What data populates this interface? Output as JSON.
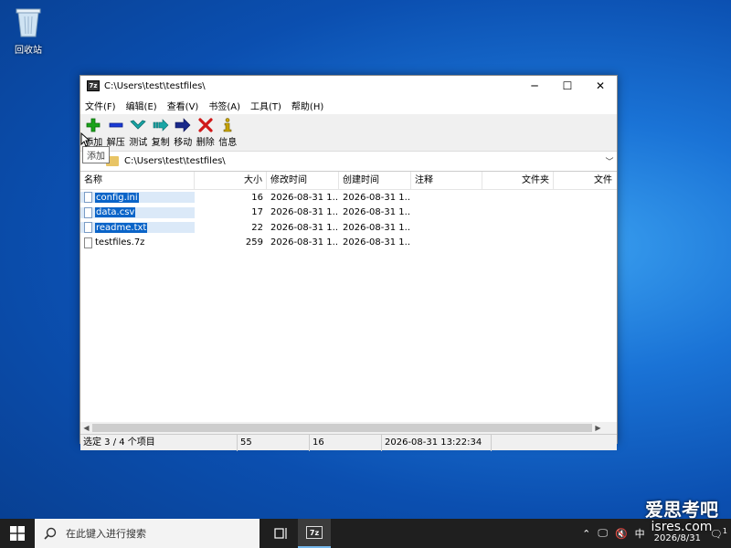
{
  "desktop": {
    "recycle_bin_label": "回收站"
  },
  "window": {
    "title": "C:\\Users\\test\\testfiles\\",
    "app_icon_text": "7z",
    "controls": {
      "minimize": "─",
      "maximize": "☐",
      "close": "✕"
    }
  },
  "menu": [
    "文件(F)",
    "编辑(E)",
    "查看(V)",
    "书签(A)",
    "工具(T)",
    "帮助(H)"
  ],
  "toolbar": [
    {
      "label": "添加",
      "icon": "add-icon",
      "color": "#1aa31a"
    },
    {
      "label": "解压",
      "icon": "extract-icon",
      "color": "#1a3bd6"
    },
    {
      "label": "测试",
      "icon": "test-icon",
      "color": "#19a6a6"
    },
    {
      "label": "复制",
      "icon": "copy-icon",
      "color": "#19a6a6"
    },
    {
      "label": "移动",
      "icon": "move-icon",
      "color": "#1a2a8a"
    },
    {
      "label": "删除",
      "icon": "delete-icon",
      "color": "#d01818"
    },
    {
      "label": "信息",
      "icon": "info-icon",
      "color": "#c8a400"
    }
  ],
  "tooltip": "添加",
  "address": {
    "path": "C:\\Users\\test\\testfiles\\"
  },
  "columns": [
    "名称",
    "大小",
    "修改时间",
    "创建时间",
    "注释",
    "文件夹",
    "文件"
  ],
  "files": [
    {
      "name": "config.ini",
      "size": "16",
      "modified": "2026-08-31 1...",
      "created": "2026-08-31 1...",
      "selected": true
    },
    {
      "name": "data.csv",
      "size": "17",
      "modified": "2026-08-31 1...",
      "created": "2026-08-31 1...",
      "selected": true
    },
    {
      "name": "readme.txt",
      "size": "22",
      "modified": "2026-08-31 1...",
      "created": "2026-08-31 1...",
      "selected": true
    },
    {
      "name": "testfiles.7z",
      "size": "259",
      "modified": "2026-08-31 1...",
      "created": "2026-08-31 1...",
      "selected": false
    }
  ],
  "status": {
    "selection": "选定 3 / 4 个项目",
    "total_size": "55",
    "selected_size": "16",
    "timestamp": "2026-08-31 13:22:34"
  },
  "watermark": {
    "line1": "爱思考吧",
    "line2": "isres.com"
  },
  "taskbar": {
    "search_placeholder": "在此键入进行搜索",
    "ime": "中",
    "date": "2026/8/31",
    "notification_count": "1"
  }
}
